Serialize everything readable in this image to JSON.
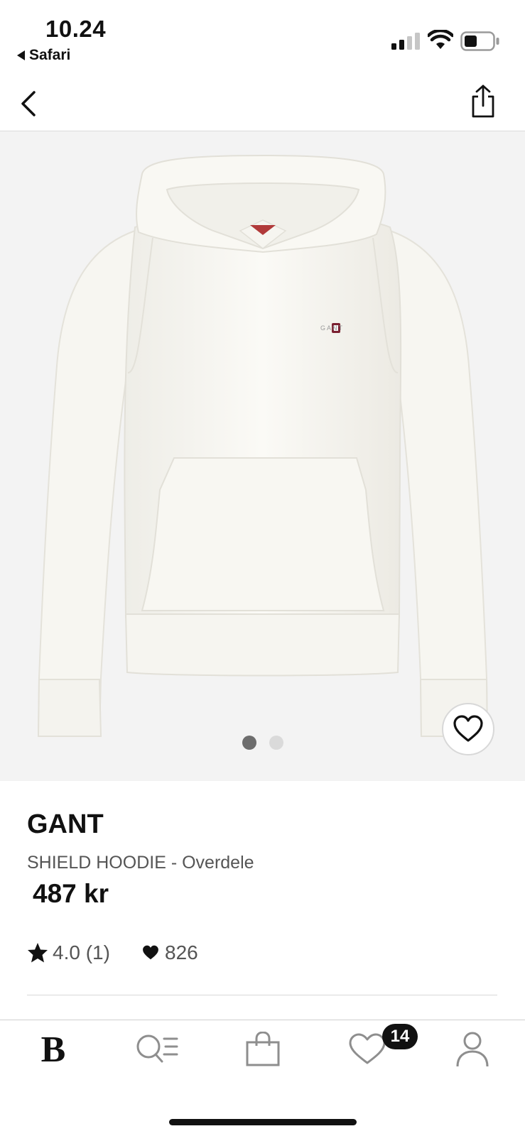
{
  "status_bar": {
    "time": "10.24",
    "back_app": "Safari"
  },
  "product": {
    "brand": "GANT",
    "name": "SHIELD HOODIE - Overdele",
    "price": "487 kr",
    "rating": "4.0 (1)",
    "likes": "826",
    "image_count": 2,
    "active_image": 1,
    "logo_text": "GANT"
  },
  "tab_bar": {
    "home_label": "B",
    "wishlist_badge": "14",
    "items": [
      "home-icon",
      "search-list-icon",
      "bag-icon",
      "heart-icon",
      "profile-icon"
    ]
  },
  "colors": {
    "background": "#ffffff",
    "image_bg": "#f3f3f3",
    "garment": "#faf9f4",
    "text_primary": "#111111",
    "text_secondary": "#555555"
  }
}
